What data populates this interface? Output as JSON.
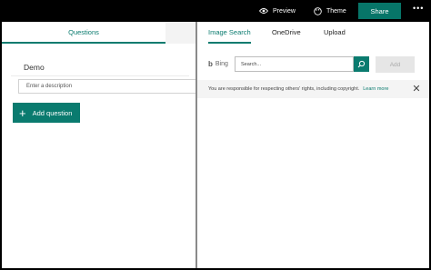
{
  "topbar": {
    "preview_label": "Preview",
    "theme_label": "Theme",
    "share_label": "Share",
    "more_label": "•••"
  },
  "left": {
    "tabs": {
      "questions": "Questions"
    },
    "form": {
      "title_value": "Demo",
      "description_placeholder": "Enter a description"
    },
    "add_question_label": "Add question"
  },
  "right": {
    "tabs": [
      {
        "label": "Image Search",
        "active": true
      },
      {
        "label": "OneDrive",
        "active": false
      },
      {
        "label": "Upload",
        "active": false
      }
    ],
    "bing_label": "Bing",
    "search_placeholder": "Search...",
    "add_label": "Add",
    "notice_text": "You are responsible for respecting others' rights, including copyright.",
    "notice_link": "Learn more"
  },
  "colors": {
    "accent": "#0a7b6f",
    "share_bg": "#077568"
  }
}
